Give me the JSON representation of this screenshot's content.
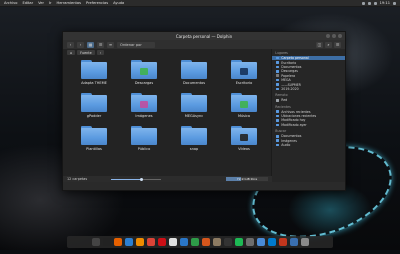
{
  "menubar": {
    "items": [
      "Archivo",
      "Editar",
      "Ver",
      "Ir",
      "Herramientas",
      "Preferencias",
      "Ayuda"
    ],
    "clock": "19:11"
  },
  "window": {
    "title": "Carpeta personal — Dolphin",
    "toolbar": {
      "sort_label": "Ordenar por"
    },
    "breadcrumb": [
      "Fuente"
    ],
    "items": [
      {
        "label": "Adapta THEME",
        "color": "#5a9ae0"
      },
      {
        "label": "Descargas",
        "color": "#5a9ae0",
        "emblem": "download-icon"
      },
      {
        "label": "Documentos",
        "color": "#5a9ae0"
      },
      {
        "label": "Escritorio",
        "color": "#5a9ae0",
        "emblem": "desktop-icon"
      },
      {
        "label": "gPodder",
        "color": "#5a9ae0"
      },
      {
        "label": "Imágenes",
        "color": "#5a9ae0",
        "emblem": "image-icon"
      },
      {
        "label": "MEGAsync",
        "color": "#5a9ae0"
      },
      {
        "label": "Música",
        "color": "#5a9ae0",
        "emblem": "music-icon"
      },
      {
        "label": "Plantillas",
        "color": "#5a9ae0"
      },
      {
        "label": "Público",
        "color": "#5a9ae0"
      },
      {
        "label": "snap",
        "color": "#5a9ae0"
      },
      {
        "label": "Vídeos",
        "color": "#5a9ae0",
        "emblem": "video-icon"
      }
    ],
    "status": {
      "count": "12 carpetas",
      "zoom_fraction": 0.6,
      "free_space": "72,9 GiB libre",
      "used_fraction": 0.35
    },
    "places": {
      "sections": [
        {
          "title": "Lugares",
          "items": [
            {
              "label": "Carpeta personal",
              "selected": true,
              "icon": "home-icon"
            },
            {
              "label": "Escritorio",
              "icon": "folder-icon"
            },
            {
              "label": "Documentos",
              "icon": "folder-icon"
            },
            {
              "label": "Descargas",
              "icon": "folder-icon"
            },
            {
              "label": "Papelera",
              "icon": "trash-icon"
            },
            {
              "label": "MEGA",
              "icon": "folder-icon"
            },
            {
              "label": "——SUPMER",
              "icon": "folder-icon"
            },
            {
              "label": "2019-2020",
              "icon": "folder-icon"
            }
          ]
        },
        {
          "title": "Remoto",
          "items": [
            {
              "label": "Red",
              "icon": "network-icon"
            }
          ]
        },
        {
          "title": "Recientes",
          "items": [
            {
              "label": "Archivos recientes",
              "icon": "clock-icon"
            },
            {
              "label": "Ubicaciones recientes",
              "icon": "clock-icon"
            },
            {
              "label": "Modificado hoy",
              "icon": "calendar-icon"
            },
            {
              "label": "Modificado ayer",
              "icon": "calendar-icon"
            }
          ]
        },
        {
          "title": "Buscar",
          "items": [
            {
              "label": "Documentos",
              "icon": "folder-icon"
            },
            {
              "label": "Imágenes",
              "icon": "folder-icon"
            },
            {
              "label": "Audio",
              "icon": "folder-icon"
            }
          ]
        }
      ]
    }
  },
  "dock": {
    "apps": [
      {
        "name": "files-icon",
        "color": "#444"
      },
      {
        "name": "terminal-icon",
        "color": "#222"
      },
      {
        "name": "firefox-icon",
        "color": "#e66000"
      },
      {
        "name": "thunderbird-icon",
        "color": "#2c7fd1"
      },
      {
        "name": "vlc-icon",
        "color": "#f08c00"
      },
      {
        "name": "chrome-icon",
        "color": "#db4437"
      },
      {
        "name": "opera-icon",
        "color": "#cc0f16"
      },
      {
        "name": "notes-icon",
        "color": "#e0e0e0"
      },
      {
        "name": "writer-icon",
        "color": "#2a76c6"
      },
      {
        "name": "calc-icon",
        "color": "#2e9c48"
      },
      {
        "name": "impress-icon",
        "color": "#d6561c"
      },
      {
        "name": "gimp-icon",
        "color": "#8d7b62"
      },
      {
        "name": "inkscape-icon",
        "color": "#333"
      },
      {
        "name": "music-icon",
        "color": "#1db954"
      },
      {
        "name": "settings-icon",
        "color": "#6d6d6d"
      },
      {
        "name": "mail-icon",
        "color": "#4a8bd6"
      },
      {
        "name": "code-icon",
        "color": "#007acc"
      },
      {
        "name": "store-icon",
        "color": "#c2361d"
      },
      {
        "name": "browser-icon",
        "color": "#3a6fb0"
      },
      {
        "name": "trash-icon",
        "color": "#8a8a8a"
      }
    ]
  }
}
